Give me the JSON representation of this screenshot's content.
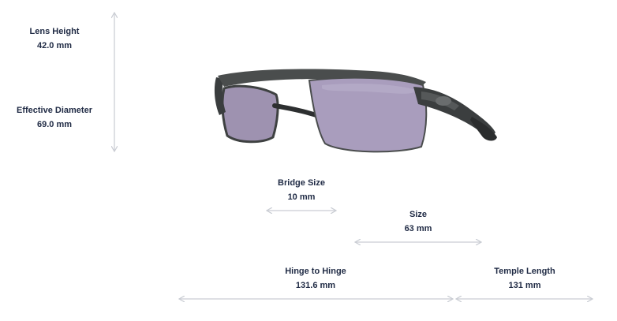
{
  "measurements": {
    "lens_height": {
      "label": "Lens Height",
      "value": "42.0 mm"
    },
    "effective_diameter": {
      "label": "Effective Diameter",
      "value": "69.0 mm"
    },
    "bridge_size": {
      "label": "Bridge Size",
      "value": "10 mm"
    },
    "size": {
      "label": "Size",
      "value": "63 mm"
    },
    "hinge_to_hinge": {
      "label": "Hinge to Hinge",
      "value": "131.6 mm"
    },
    "temple_length": {
      "label": "Temple Length",
      "value": "131 mm"
    }
  },
  "colors": {
    "text": "#1f2a44",
    "arrow": "#c9ccd3",
    "lens": "#a79bb8",
    "frame": "#3c3f3f"
  },
  "image": {
    "icon": "sunglasses-product-image"
  }
}
